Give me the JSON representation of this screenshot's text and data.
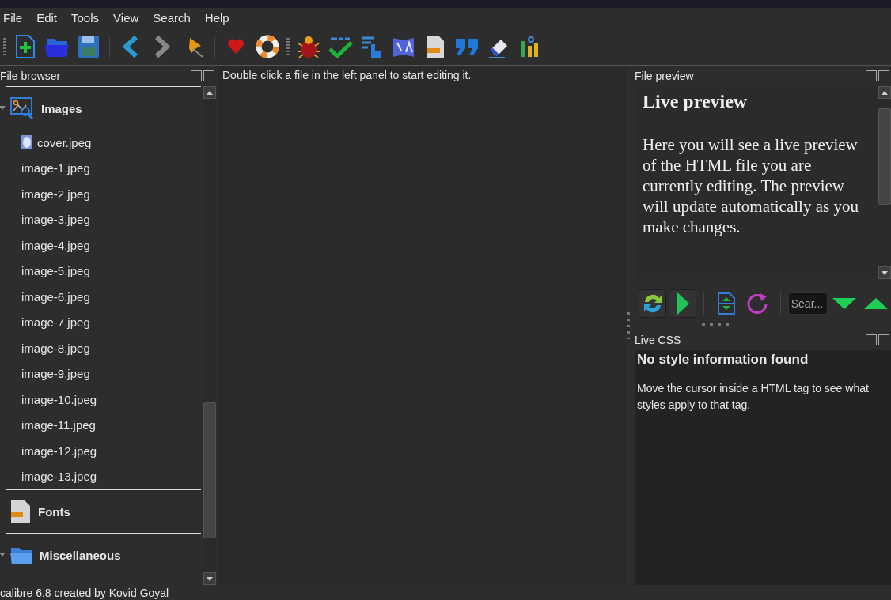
{
  "menu": [
    {
      "label": "File"
    },
    {
      "label": "Edit"
    },
    {
      "label": "Tools"
    },
    {
      "label": "View"
    },
    {
      "label": "Search"
    },
    {
      "label": "Help"
    }
  ],
  "file_browser": {
    "title": "File browser",
    "folders": [
      {
        "name": "Images",
        "kind": "images",
        "expanded": true,
        "children": [
          {
            "name": "cover.jpeg",
            "kind": "cover"
          },
          {
            "name": "image-1.jpeg",
            "kind": "plain"
          },
          {
            "name": "image-2.jpeg",
            "kind": "plain"
          },
          {
            "name": "image-3.jpeg",
            "kind": "plain"
          },
          {
            "name": "image-4.jpeg",
            "kind": "plain"
          },
          {
            "name": "image-5.jpeg",
            "kind": "plain"
          },
          {
            "name": "image-6.jpeg",
            "kind": "plain"
          },
          {
            "name": "image-7.jpeg",
            "kind": "plain"
          },
          {
            "name": "image-8.jpeg",
            "kind": "plain"
          },
          {
            "name": "image-9.jpeg",
            "kind": "plain"
          },
          {
            "name": "image-10.jpeg",
            "kind": "plain"
          },
          {
            "name": "image-11.jpeg",
            "kind": "plain"
          },
          {
            "name": "image-12.jpeg",
            "kind": "plain"
          },
          {
            "name": "image-13.jpeg",
            "kind": "plain"
          }
        ]
      },
      {
        "name": "Fonts",
        "kind": "fonts",
        "expanded": false
      },
      {
        "name": "Miscellaneous",
        "kind": "misc",
        "expanded": true
      }
    ]
  },
  "editor": {
    "message": "Double click a file in the left panel to start editing it."
  },
  "file_preview": {
    "title": "File preview",
    "heading": "Live preview",
    "body": "Here you will see a live preview of the HTML file you are currently editing. The preview will update automatically as you make changes.",
    "search": {
      "placeholder": "Sear..."
    }
  },
  "live_css": {
    "title": "Live CSS",
    "heading": "No style information found",
    "body": "Move the cursor inside a HTML tag to see what styles apply to that tag."
  },
  "status_bar": {
    "text": "calibre 6.8 created by Kovid Goyal"
  }
}
